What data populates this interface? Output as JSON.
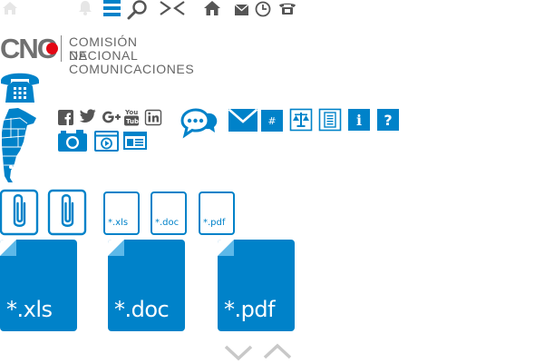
{
  "colors": {
    "accent": "#0082c9",
    "gray": "#888888",
    "light_gray": "#c8c8c8"
  },
  "logo": {
    "brand": "CNC",
    "line1": "COMISIÓN NACIONAL",
    "line2": "DE COMUNICACIONES"
  },
  "top_icons": [
    "home-icon-faint",
    "bell-icon-faint",
    "menu-icon",
    "search-icon",
    "collapse-icon",
    "home-icon",
    "mail-icon",
    "clock-icon",
    "phone-icon"
  ],
  "social_icons": [
    "facebook-icon",
    "twitter-icon",
    "google-plus-icon",
    "youtube-icon",
    "linkedin-icon"
  ],
  "media_icons": [
    "camera-icon",
    "video-icon",
    "news-icon"
  ],
  "action_buttons": {
    "chat": "chat-icon",
    "mail": "mail-icon",
    "hash_label": "#",
    "law": "scales-icon",
    "document": "document-icon",
    "info_label": "i",
    "help_label": "?"
  },
  "small_files": {
    "xls_label": "*.xls",
    "doc_label": "*.doc",
    "pdf_label": "*.pdf"
  },
  "big_files": {
    "xls_label": "*.xls",
    "doc_label": "*.doc",
    "pdf_label": "*.pdf"
  },
  "pager": {
    "down": "chevron-down-icon",
    "up": "chevron-up-icon"
  }
}
